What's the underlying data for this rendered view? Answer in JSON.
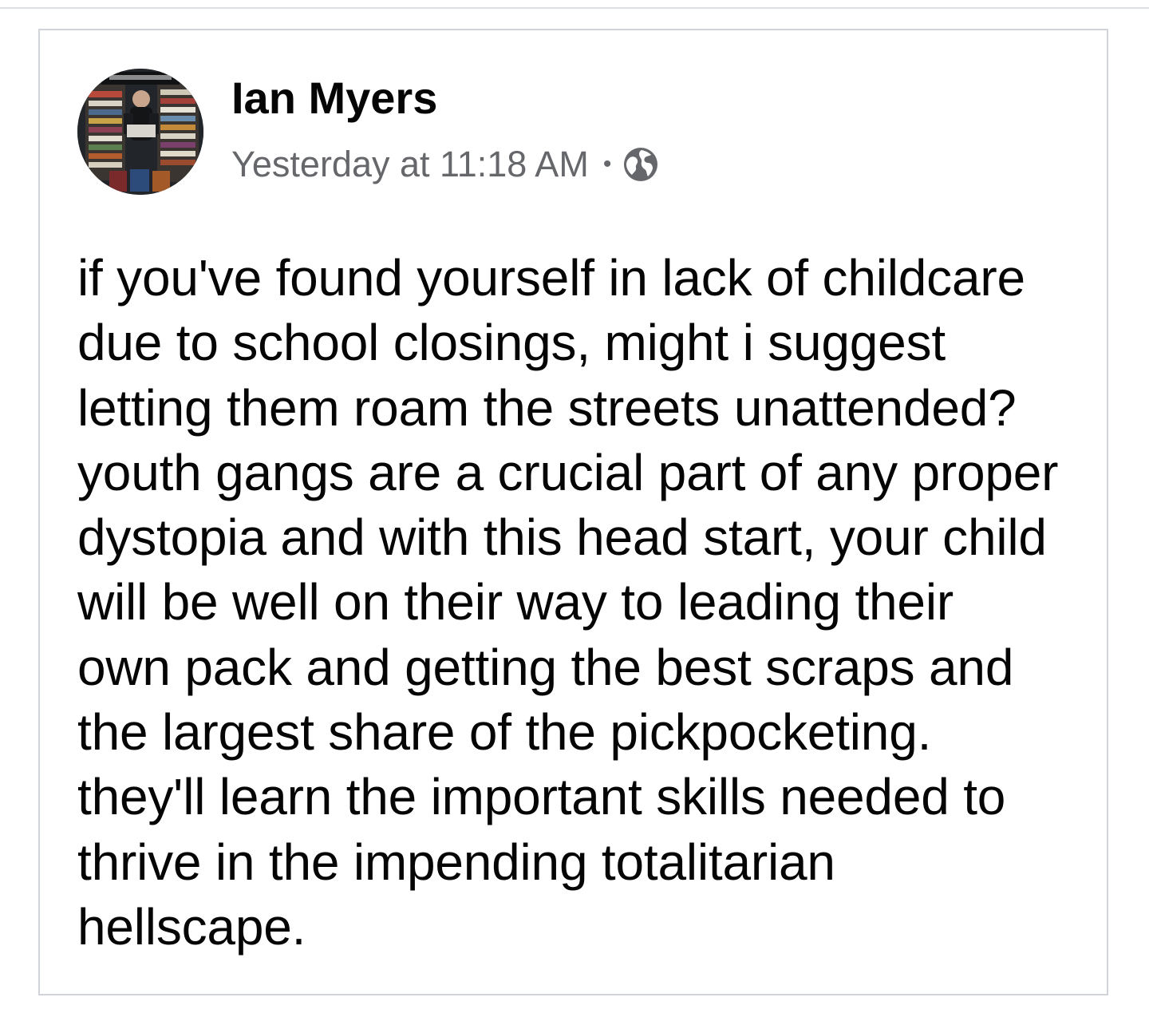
{
  "post": {
    "author": "Ian Myers",
    "timestamp": "Yesterday at 11:18 AM",
    "separator": "•",
    "privacy_icon": "globe-icon",
    "body": "if you've found yourself in lack of childcare\ndue to school closings, might i suggest\nletting them roam the streets unattended?\nyouth gangs are a crucial part of any proper\ndystopia and with this head start, your child\nwill be well on their way to leading their\nown pack and getting the best scraps and\nthe largest share of the pickpocketing.\nthey'll learn the important skills needed to\nthrive in the impending totalitarian\nhellscape."
  },
  "colors": {
    "text_primary": "#050505",
    "text_secondary": "#65676b",
    "card_border": "#d0d4da"
  }
}
